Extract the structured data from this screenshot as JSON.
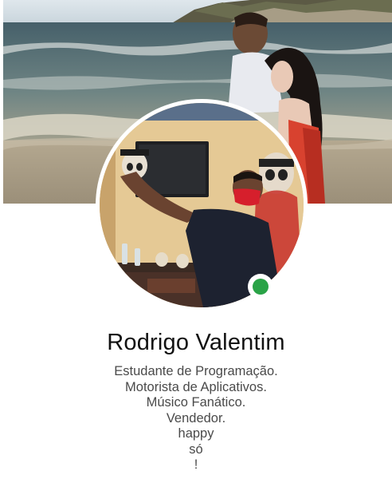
{
  "profile": {
    "name": "Rodrigo Valentim",
    "online": true,
    "online_color": "#2aa347"
  },
  "bio": {
    "lines": [
      "Estudante de Programação.",
      "Motorista de Aplicativos.",
      "Músico Fanático.",
      "Vendedor.",
      "happy",
      "só",
      "!"
    ]
  },
  "icons": {
    "presence": "online-status-dot"
  }
}
